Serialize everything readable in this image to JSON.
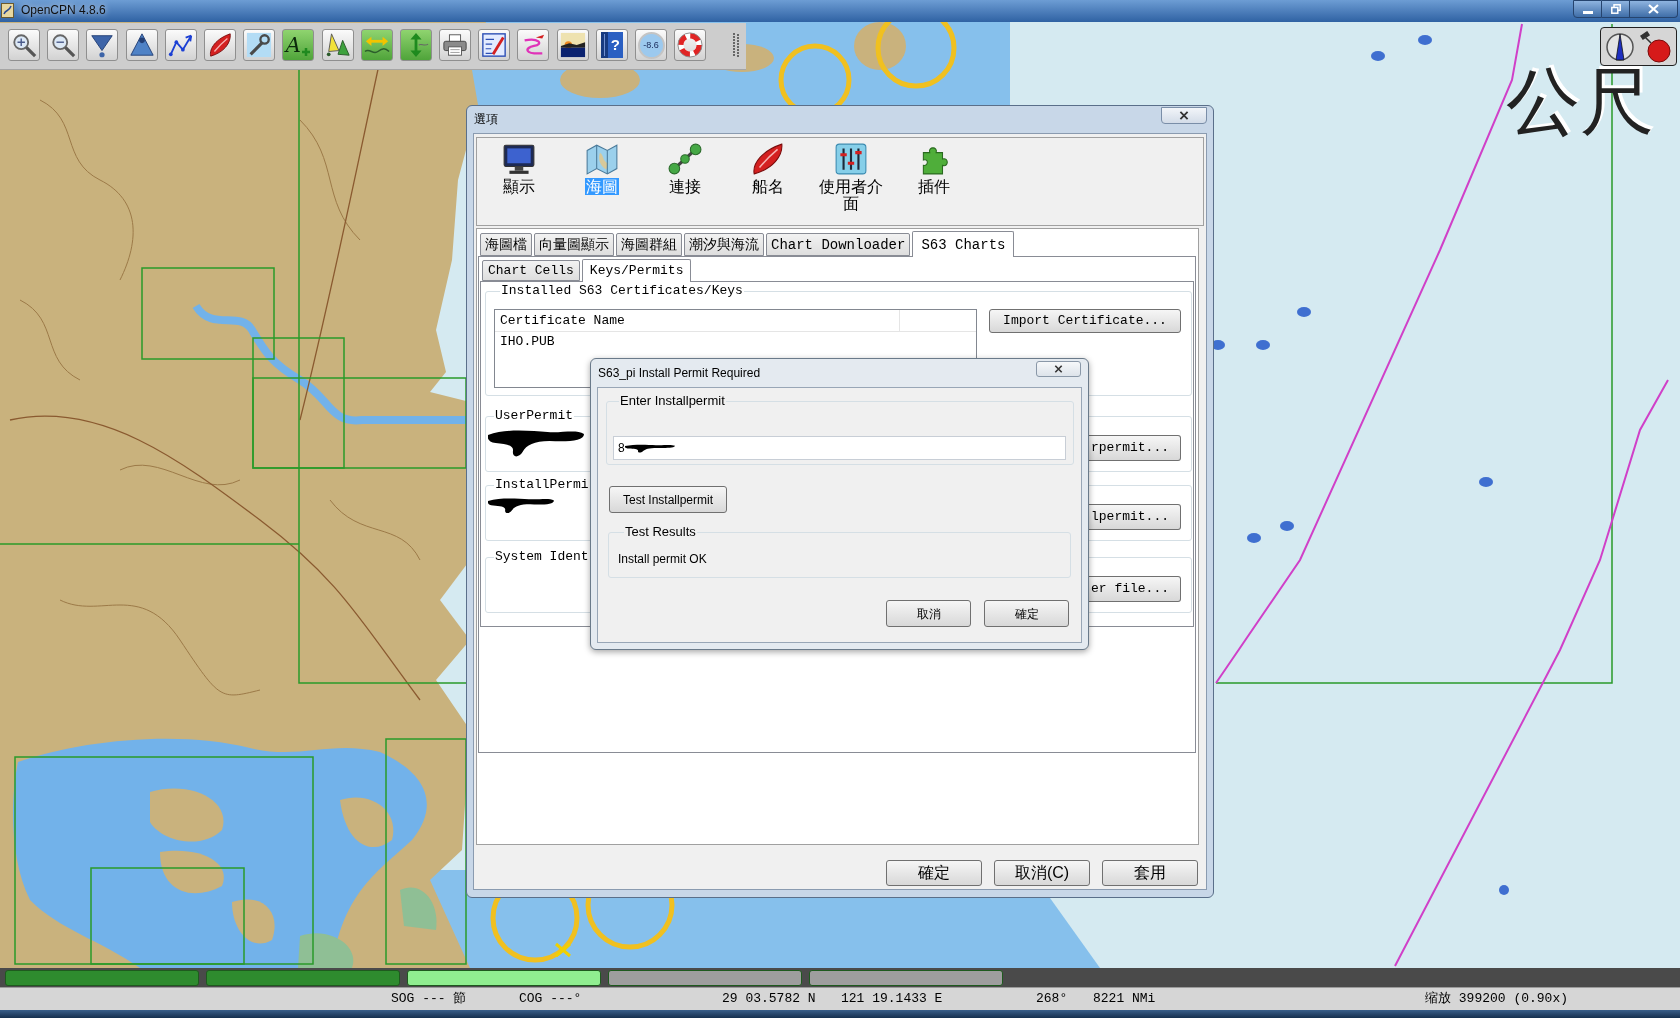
{
  "window": {
    "title": "OpenCPN 4.8.6"
  },
  "toolbar": [
    {
      "kind": "zoom_in",
      "on": false
    },
    {
      "kind": "zoom_out",
      "on": false
    },
    {
      "kind": "scale_in",
      "on": false
    },
    {
      "kind": "scale_out",
      "on": false
    },
    {
      "kind": "route",
      "on": false
    },
    {
      "kind": "follow",
      "on": false
    },
    {
      "kind": "settings",
      "on": false
    },
    {
      "kind": "text",
      "glyph": "A",
      "on": true
    },
    {
      "kind": "ais",
      "on": false
    },
    {
      "kind": "quilt",
      "on": true
    },
    {
      "kind": "currents",
      "on": true
    },
    {
      "kind": "print",
      "on": false
    },
    {
      "kind": "route_manager",
      "on": false
    },
    {
      "kind": "track",
      "on": false
    },
    {
      "kind": "color_scheme",
      "on": false
    },
    {
      "kind": "help",
      "glyph": "?",
      "on": false
    },
    {
      "kind": "tides",
      "glyph": "-8.6",
      "on": false
    },
    {
      "kind": "mob",
      "on": false
    }
  ],
  "chart": {
    "depth_units": "公尺"
  },
  "options_dialog": {
    "title": "選項",
    "categories": [
      {
        "kind": "display",
        "label": "顯示",
        "selected": false
      },
      {
        "kind": "charts",
        "label": "海圖",
        "selected": true
      },
      {
        "kind": "connections",
        "label": "連接",
        "selected": false
      },
      {
        "kind": "ships",
        "label": "船名",
        "selected": false
      },
      {
        "kind": "ui",
        "label": "使用者介面",
        "selected": false
      },
      {
        "kind": "plugins",
        "label": "插件",
        "selected": false
      }
    ],
    "tabs": [
      {
        "label": "海圖檔",
        "selected": false
      },
      {
        "label": "向量圖顯示",
        "selected": false
      },
      {
        "label": "海圖群組",
        "selected": false
      },
      {
        "label": "潮汐與海流",
        "selected": false
      },
      {
        "label": "Chart Downloader",
        "selected": false
      },
      {
        "label": "S63 Charts",
        "selected": true
      }
    ],
    "subtabs": [
      {
        "label": "Chart Cells",
        "selected": false
      },
      {
        "label": "Keys/Permits",
        "selected": true
      }
    ],
    "certificates": {
      "legend": "Installed S63 Certificates/Keys",
      "column_1": "Certificate Name",
      "rows": [
        "IHO.PUB"
      ],
      "import_button": "Import Certificate..."
    },
    "groups": [
      {
        "legend": "UserPermit",
        "redacted": true,
        "button": "rpermit..."
      },
      {
        "legend": "InstallPermi",
        "redacted": true,
        "button": "lpermit..."
      },
      {
        "legend": "System Ident",
        "redacted": false,
        "button": "er file..."
      }
    ],
    "buttons": [
      "確定",
      "取消(C)",
      "套用"
    ]
  },
  "permit_dialog": {
    "title": "S63_pi Install Permit Required",
    "entry_legend": "Enter Installpermit",
    "value": "8",
    "value_redacted": true,
    "test_button": "Test Installpermit",
    "results_legend": "Test Results",
    "result": "Install permit OK",
    "buttons": [
      "取消",
      "確定"
    ]
  },
  "chart_bar": [
    {
      "color": "#2e8b2e"
    },
    {
      "color": "#2e8b2e"
    },
    {
      "color": "#90ee90"
    },
    {
      "color": "#9e9e9e"
    },
    {
      "color": "#9e9e9e"
    }
  ],
  "status_bar": [
    "SOG --- 節",
    "COG ---°",
    "29 03.5782 N",
    "121 19.1433 E",
    "268°",
    "8221 NMi",
    "缩放 399200 (0.90x)"
  ]
}
